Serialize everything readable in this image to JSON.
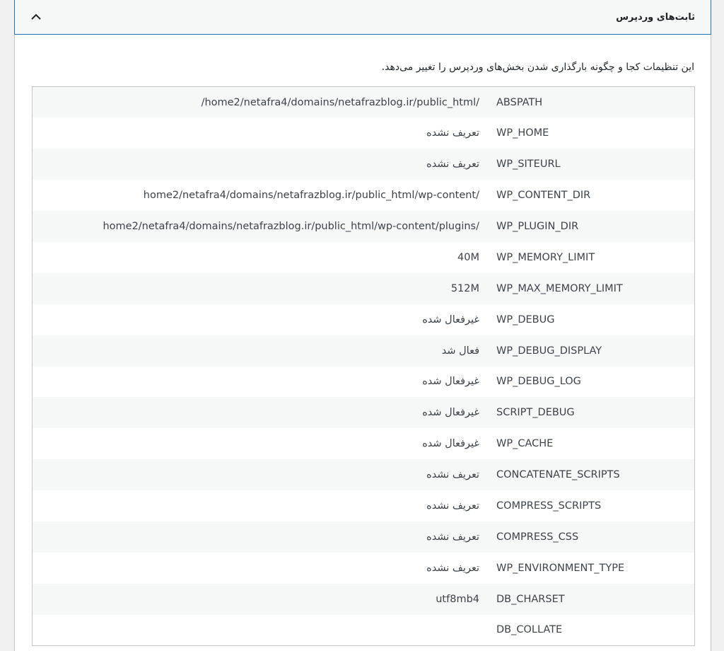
{
  "section": {
    "title": "ثابت‌های وردپرس",
    "description": "این تنظیمات کجا و چگونه بارگذاری شدن بخش‌های وردپرس را تغییر می‌دهد.",
    "toggle_icon": "chevron-up-icon"
  },
  "rows": [
    {
      "key": "ABSPATH",
      "value": "/home2/netafra4/domains/netafrazblog.ir/public_html/"
    },
    {
      "key": "WP_HOME",
      "value": "تعریف نشده"
    },
    {
      "key": "WP_SITEURL",
      "value": "تعریف نشده"
    },
    {
      "key": "WP_CONTENT_DIR",
      "value": "/home2/netafra4/domains/netafrazblog.ir/public_html/wp-content"
    },
    {
      "key": "WP_PLUGIN_DIR",
      "value": "/home2/netafra4/domains/netafrazblog.ir/public_html/wp-content/plugins"
    },
    {
      "key": "WP_MEMORY_LIMIT",
      "value": "40M"
    },
    {
      "key": "WP_MAX_MEMORY_LIMIT",
      "value": "512M"
    },
    {
      "key": "WP_DEBUG",
      "value": "غیرفعال شده"
    },
    {
      "key": "WP_DEBUG_DISPLAY",
      "value": "فعال شد"
    },
    {
      "key": "WP_DEBUG_LOG",
      "value": "غیرفعال شده"
    },
    {
      "key": "SCRIPT_DEBUG",
      "value": "غیرفعال شده"
    },
    {
      "key": "WP_CACHE",
      "value": "غیرفعال شده"
    },
    {
      "key": "CONCATENATE_SCRIPTS",
      "value": "تعریف نشده"
    },
    {
      "key": "COMPRESS_SCRIPTS",
      "value": "تعریف نشده"
    },
    {
      "key": "COMPRESS_CSS",
      "value": "تعریف نشده"
    },
    {
      "key": "WP_ENVIRONMENT_TYPE",
      "value": "تعریف نشده"
    },
    {
      "key": "DB_CHARSET",
      "value": "utf8mb4"
    },
    {
      "key": "DB_COLLATE",
      "value": ""
    }
  ]
}
